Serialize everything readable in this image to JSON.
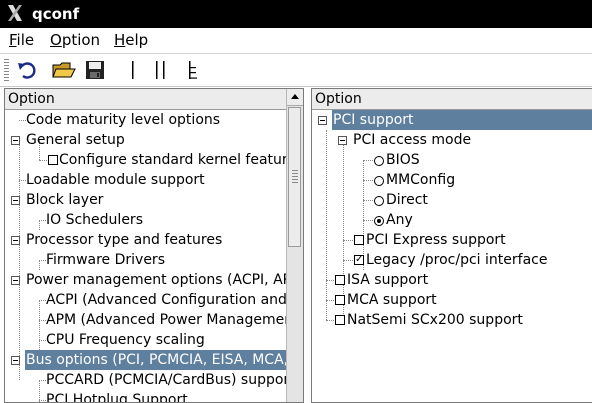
{
  "window": {
    "title": "qconf"
  },
  "menubar": {
    "file": {
      "accel": "F",
      "rest": "ile"
    },
    "option": {
      "accel": "O",
      "rest": "ption"
    },
    "help": {
      "accel": "H",
      "rest": "elp"
    }
  },
  "toolbar": {
    "buttons": [
      "back-icon",
      "open-folder-icon",
      "save-disk-icon",
      "single-view-icon",
      "split-view-icon",
      "full-view-icon"
    ]
  },
  "left_pane": {
    "header": "Option",
    "items": [
      "Code maturity level options",
      "General setup",
      "Configure standard kernel features",
      "Loadable module support",
      "Block layer",
      "IO Schedulers",
      "Processor type and features",
      "Firmware Drivers",
      "Power management options (ACPI, APM)",
      "ACPI (Advanced Configuration and Power Interface)",
      "APM (Advanced Power Management)",
      "CPU Frequency scaling",
      "Bus options (PCI, PCMCIA, EISA, MCA, ISA)",
      "PCCARD (PCMCIA/CardBus) support",
      "PCI Hotplug Support"
    ]
  },
  "right_pane": {
    "header": "Option",
    "items": [
      "PCI support",
      "PCI access mode",
      "BIOS",
      "MMConfig",
      "Direct",
      "Any",
      "PCI Express support",
      "Legacy /proc/pci interface",
      "ISA support",
      "MCA support",
      "NatSemi SCx200 support"
    ]
  },
  "colors": {
    "selection": "#5f7f9f",
    "titlebar": "#000000"
  }
}
